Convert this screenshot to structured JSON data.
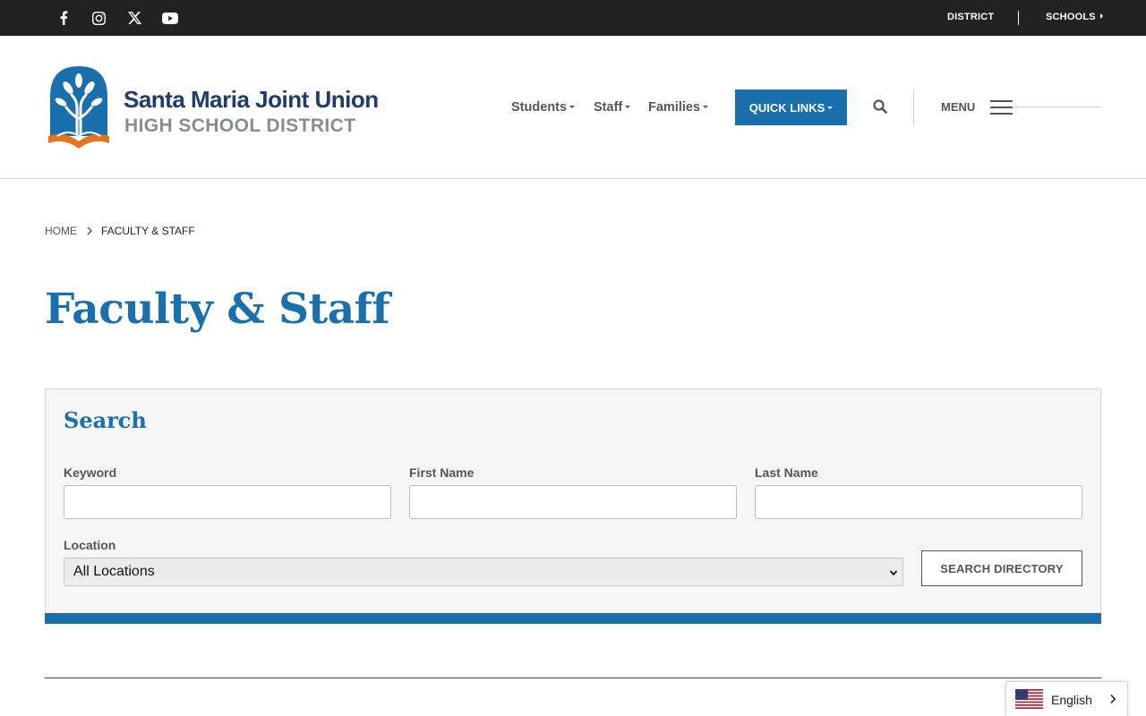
{
  "colors": {
    "brand_blue": "#1a6fad",
    "navy": "#1d3d6c",
    "topbar": "#222222",
    "logo_orange": "#e8731f"
  },
  "topbar": {
    "social_icons": [
      "facebook-icon",
      "instagram-icon",
      "x-icon",
      "youtube-icon"
    ],
    "links": {
      "district": "DISTRICT",
      "schools": "SCHOOLS"
    }
  },
  "logo": {
    "line1": "Santa Maria Joint Union",
    "line2": "HIGH SCHOOL DISTRICT"
  },
  "nav": {
    "items": [
      "Students",
      "Staff",
      "Families"
    ],
    "quick_links": "QUICK LINKS",
    "menu": "MENU"
  },
  "breadcrumb": {
    "home": "HOME",
    "current": "FACULTY & STAFF"
  },
  "page": {
    "title": "Faculty & Staff"
  },
  "search_panel": {
    "title": "Search",
    "keyword": {
      "label": "Keyword",
      "value": ""
    },
    "first_name": {
      "label": "First Name",
      "value": ""
    },
    "last_name": {
      "label": "Last Name",
      "value": ""
    },
    "location": {
      "label": "Location",
      "selected": "All Locations"
    },
    "submit": "SEARCH DIRECTORY"
  },
  "language": {
    "selected": "English"
  }
}
